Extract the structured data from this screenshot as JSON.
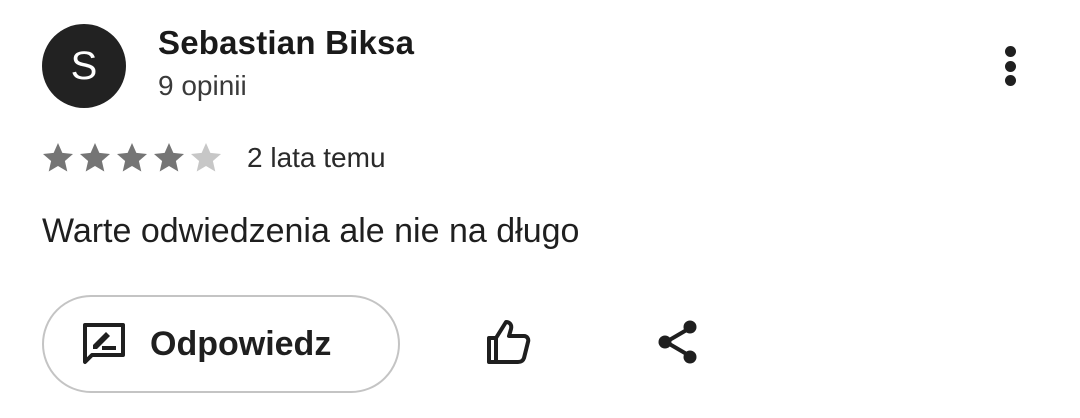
{
  "review": {
    "author": {
      "initial": "S",
      "name": "Sebastian Biksa",
      "reviews_count": "9 opinii",
      "avatar_color": "#222222"
    },
    "rating": {
      "value": 4,
      "max": 5,
      "filled_color": "#757575",
      "empty_color": "#c7c7c7"
    },
    "date": "2 lata temu",
    "text": "Warte odwiedzenia ale nie na długo"
  },
  "actions": {
    "more_icon": "more-vertical-icon",
    "reply_label": "Odpowiedz",
    "reply_icon": "rate-review-icon",
    "like_icon": "thumb-up-icon",
    "share_icon": "share-icon"
  }
}
